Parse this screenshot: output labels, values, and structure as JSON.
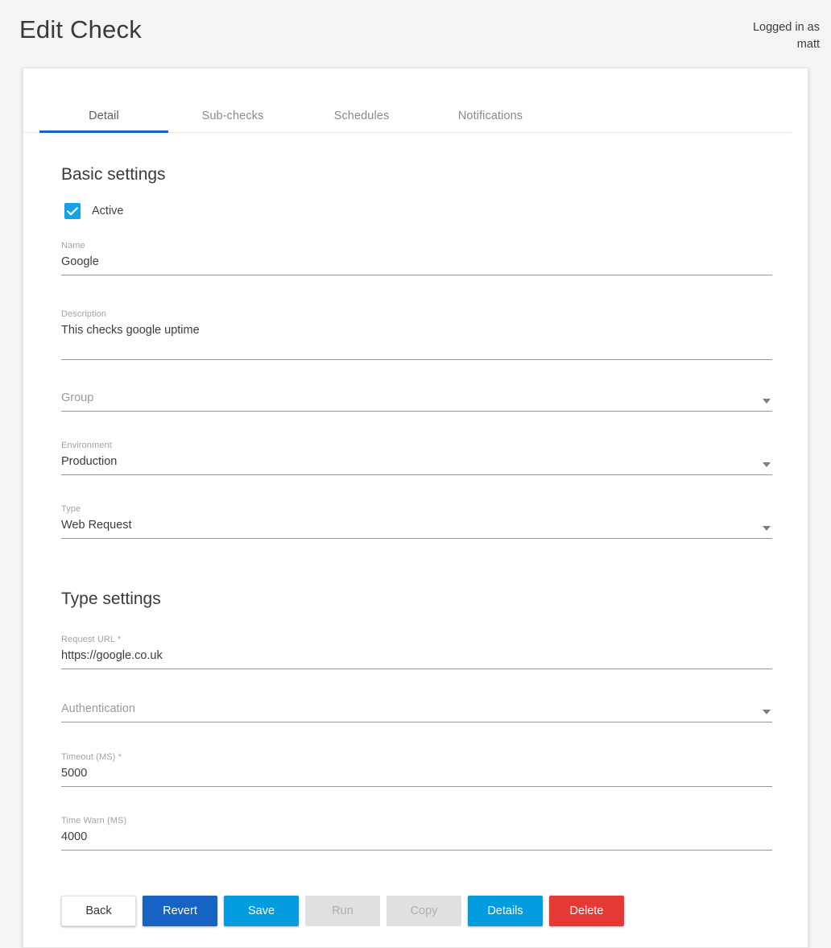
{
  "header": {
    "title": "Edit Check",
    "logged_in_label": "Logged in as",
    "username": "matt"
  },
  "tabs": [
    {
      "label": "Detail",
      "active": true
    },
    {
      "label": "Sub-checks",
      "active": false
    },
    {
      "label": "Schedules",
      "active": false
    },
    {
      "label": "Notifications",
      "active": false
    }
  ],
  "basic_settings": {
    "title": "Basic settings",
    "active": {
      "label": "Active",
      "checked": true
    },
    "name": {
      "label": "Name",
      "value": "Google"
    },
    "description": {
      "label": "Description",
      "value": "This checks google uptime"
    },
    "group": {
      "label": "",
      "placeholder": "Group",
      "value": ""
    },
    "environment": {
      "label": "Environment",
      "value": "Production"
    },
    "type": {
      "label": "Type",
      "value": "Web Request"
    }
  },
  "type_settings": {
    "title": "Type settings",
    "request_url": {
      "label": "Request URL *",
      "value": "https://google.co.uk"
    },
    "authentication": {
      "label": "",
      "placeholder": "Authentication",
      "value": ""
    },
    "timeout": {
      "label": "Timeout (MS) *",
      "value": "5000"
    },
    "time_warn": {
      "label": "Time Warn (MS)",
      "value": "4000"
    }
  },
  "buttons": {
    "back": "Back",
    "revert": "Revert",
    "save": "Save",
    "run": "Run",
    "copy": "Copy",
    "details": "Details",
    "delete": "Delete"
  },
  "colors": {
    "accent_primary": "#1565c0",
    "accent_light": "#039ce0",
    "danger": "#e53935",
    "checkbox": "#14a3e8",
    "page_bg": "#f4f4f4",
    "disabled_bg": "#e0e0e0"
  }
}
